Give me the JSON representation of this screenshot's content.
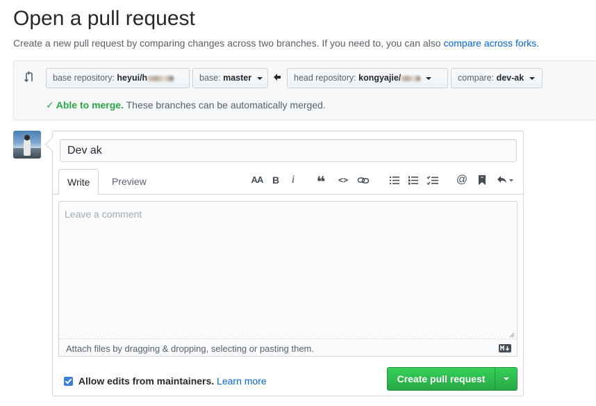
{
  "page": {
    "title": "Open a pull request",
    "subtitle_prefix": "Create a new pull request by comparing changes across two branches. If you need to, you can also ",
    "subtitle_link": "compare across forks",
    "subtitle_suffix": "."
  },
  "range": {
    "base_repo_label": "base repository:",
    "base_repo_value": "heyui/h",
    "base_label": "base:",
    "base_value": "master",
    "head_repo_label": "head repository:",
    "head_repo_value": "kongyajie/",
    "compare_label": "compare:",
    "compare_value": "dev-ak",
    "merge_ok": "Able to merge.",
    "merge_text": "These branches can be automatically merged."
  },
  "form": {
    "title_value": "Dev ak",
    "tab_write": "Write",
    "tab_preview": "Preview",
    "comment_placeholder": "Leave a comment",
    "attach_text": "Attach files by dragging & dropping, selecting or pasting them.",
    "allow_edits_label": "Allow edits from maintainers.",
    "learn_more": "Learn more",
    "create_button": "Create pull request"
  },
  "toolbar": {
    "header_glyph": "AA",
    "bold_glyph": "B",
    "italic_glyph": "i",
    "quote_glyph": "❝",
    "code_glyph": "<>",
    "mention_glyph": "@"
  },
  "colors": {
    "accent_link": "#0366d6",
    "success_green": "#28a745",
    "button_green": "#2ea44f"
  }
}
